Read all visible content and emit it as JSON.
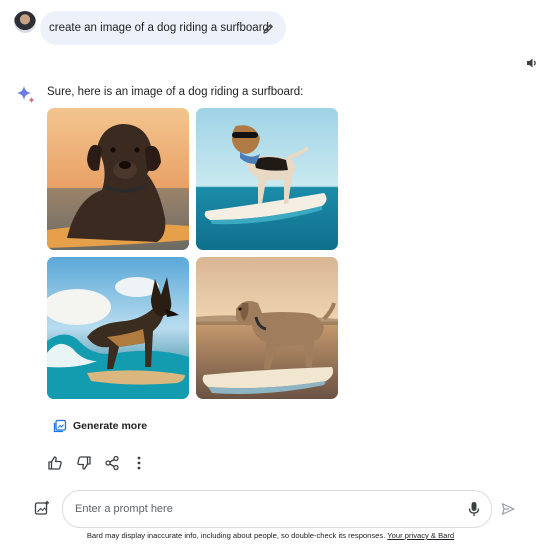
{
  "conversation": {
    "user_prompt": "create an image of a dog riding a surfboard",
    "reply_text": "Sure, here is an image of a dog riding a surfboard:",
    "images": [
      {
        "alt": "Chocolate labrador lying on a surfboard at sunset"
      },
      {
        "alt": "Beagle wearing sunglasses and bandana standing on a surfboard"
      },
      {
        "alt": "German shepherd riding a wave on a surfboard"
      },
      {
        "alt": "Labrador walking on a surfboard at golden hour"
      }
    ],
    "generate_more_label": "Generate more"
  },
  "input": {
    "placeholder": "Enter a prompt here"
  },
  "footer": {
    "disclaimer": "Bard may display inaccurate info, including about people, so double-check its responses.",
    "privacy_link": "Your privacy & Bard"
  },
  "icons": {
    "edit": "pencil-icon",
    "speaker": "speaker-icon",
    "sparkle": "bard-sparkle-icon",
    "thumbs_up": "thumbs-up-icon",
    "thumbs_down": "thumbs-down-icon",
    "share": "share-icon",
    "more": "more-vertical-icon",
    "add_image": "add-image-icon",
    "mic": "microphone-icon",
    "send": "send-icon"
  },
  "colors": {
    "user_bubble": "#edf2fa",
    "accent_blue": "#4285f4",
    "text": "#1f1f1f",
    "border": "#dadce0"
  }
}
